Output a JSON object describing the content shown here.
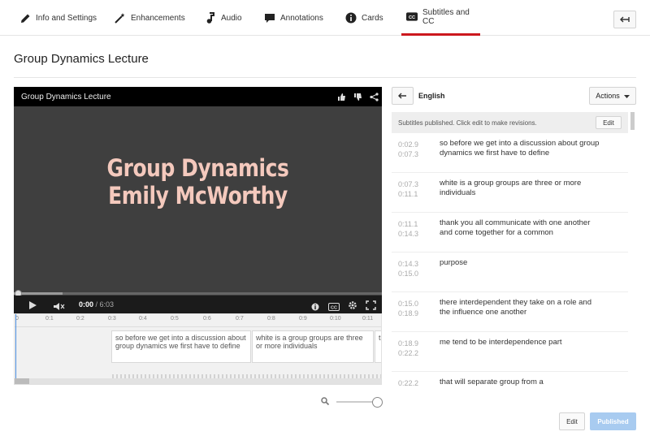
{
  "tabs": [
    {
      "label": "Info and Settings",
      "icon": "pencil-icon"
    },
    {
      "label": "Enhancements",
      "icon": "magic-wand-icon"
    },
    {
      "label": "Audio",
      "icon": "music-note-icon"
    },
    {
      "label": "Annotations",
      "icon": "speech-bubble-icon"
    },
    {
      "label": "Cards",
      "icon": "info-circle-icon"
    },
    {
      "label": "Subtitles and CC",
      "icon": "cc-icon",
      "active": true
    }
  ],
  "page": {
    "title": "Group Dynamics Lecture"
  },
  "player": {
    "title": "Group Dynamics Lecture",
    "slide_line1": "Group Dynamics",
    "slide_line2": "Emily McWorthy",
    "current_time": "0:00",
    "duration": "/ 6:03"
  },
  "timeline": {
    "ticks": [
      "0",
      "0:1",
      "0:2",
      "0:3",
      "0:4",
      "0:5",
      "0:6",
      "0:7",
      "0:8",
      "0:9",
      "0:10",
      "0:11"
    ],
    "blocks": [
      "so before we get into a discussion about group dynamics we first have to define",
      "white is a group groups are three or more individuals",
      "t"
    ]
  },
  "panel": {
    "language": "English",
    "actions_label": "Actions",
    "status_text": "Subtitles published. Click edit to make revisions.",
    "status_edit": "Edit",
    "captions": [
      {
        "start": "0:02.9",
        "end": "0:07.3",
        "text": "so before we get into a discussion about group dynamics we first have to define"
      },
      {
        "start": "0:07.3",
        "end": "0:11.1",
        "text": "white is a group groups are three or more individuals"
      },
      {
        "start": "0:11.1",
        "end": "0:14.3",
        "text": "thank you all communicate with one another and come together for a common"
      },
      {
        "start": "0:14.3",
        "end": "0:15.0",
        "text": "purpose"
      },
      {
        "start": "0:15.0",
        "end": "0:18.9",
        "text": "there interdependent they take on a role and the influence one another"
      },
      {
        "start": "0:18.9",
        "end": "0:22.2",
        "text": "me tend to be interdependence part"
      },
      {
        "start": "0:22.2",
        "end": "",
        "text": "that will separate group from a"
      }
    ]
  },
  "footer": {
    "edit_label": "Edit",
    "published_label": "Published"
  },
  "colors": {
    "accent_red": "#cc181e",
    "published_blue": "#a8cbf0"
  }
}
